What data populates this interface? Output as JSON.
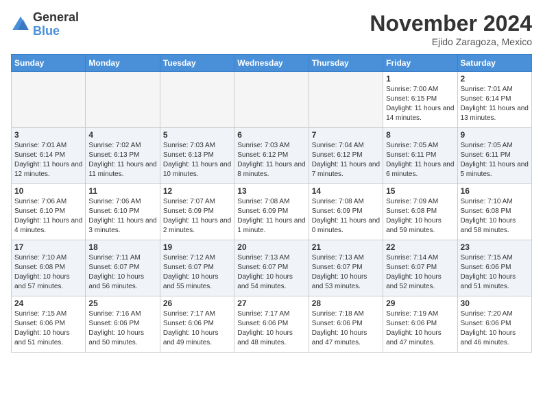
{
  "logo": {
    "general": "General",
    "blue": "Blue"
  },
  "title": "November 2024",
  "location": "Ejido Zaragoza, Mexico",
  "weekdays": [
    "Sunday",
    "Monday",
    "Tuesday",
    "Wednesday",
    "Thursday",
    "Friday",
    "Saturday"
  ],
  "weeks": [
    [
      {
        "day": "",
        "info": ""
      },
      {
        "day": "",
        "info": ""
      },
      {
        "day": "",
        "info": ""
      },
      {
        "day": "",
        "info": ""
      },
      {
        "day": "",
        "info": ""
      },
      {
        "day": "1",
        "info": "Sunrise: 7:00 AM\nSunset: 6:15 PM\nDaylight: 11 hours and 14 minutes."
      },
      {
        "day": "2",
        "info": "Sunrise: 7:01 AM\nSunset: 6:14 PM\nDaylight: 11 hours and 13 minutes."
      }
    ],
    [
      {
        "day": "3",
        "info": "Sunrise: 7:01 AM\nSunset: 6:14 PM\nDaylight: 11 hours and 12 minutes."
      },
      {
        "day": "4",
        "info": "Sunrise: 7:02 AM\nSunset: 6:13 PM\nDaylight: 11 hours and 11 minutes."
      },
      {
        "day": "5",
        "info": "Sunrise: 7:03 AM\nSunset: 6:13 PM\nDaylight: 11 hours and 10 minutes."
      },
      {
        "day": "6",
        "info": "Sunrise: 7:03 AM\nSunset: 6:12 PM\nDaylight: 11 hours and 8 minutes."
      },
      {
        "day": "7",
        "info": "Sunrise: 7:04 AM\nSunset: 6:12 PM\nDaylight: 11 hours and 7 minutes."
      },
      {
        "day": "8",
        "info": "Sunrise: 7:05 AM\nSunset: 6:11 PM\nDaylight: 11 hours and 6 minutes."
      },
      {
        "day": "9",
        "info": "Sunrise: 7:05 AM\nSunset: 6:11 PM\nDaylight: 11 hours and 5 minutes."
      }
    ],
    [
      {
        "day": "10",
        "info": "Sunrise: 7:06 AM\nSunset: 6:10 PM\nDaylight: 11 hours and 4 minutes."
      },
      {
        "day": "11",
        "info": "Sunrise: 7:06 AM\nSunset: 6:10 PM\nDaylight: 11 hours and 3 minutes."
      },
      {
        "day": "12",
        "info": "Sunrise: 7:07 AM\nSunset: 6:09 PM\nDaylight: 11 hours and 2 minutes."
      },
      {
        "day": "13",
        "info": "Sunrise: 7:08 AM\nSunset: 6:09 PM\nDaylight: 11 hours and 1 minute."
      },
      {
        "day": "14",
        "info": "Sunrise: 7:08 AM\nSunset: 6:09 PM\nDaylight: 11 hours and 0 minutes."
      },
      {
        "day": "15",
        "info": "Sunrise: 7:09 AM\nSunset: 6:08 PM\nDaylight: 10 hours and 59 minutes."
      },
      {
        "day": "16",
        "info": "Sunrise: 7:10 AM\nSunset: 6:08 PM\nDaylight: 10 hours and 58 minutes."
      }
    ],
    [
      {
        "day": "17",
        "info": "Sunrise: 7:10 AM\nSunset: 6:08 PM\nDaylight: 10 hours and 57 minutes."
      },
      {
        "day": "18",
        "info": "Sunrise: 7:11 AM\nSunset: 6:07 PM\nDaylight: 10 hours and 56 minutes."
      },
      {
        "day": "19",
        "info": "Sunrise: 7:12 AM\nSunset: 6:07 PM\nDaylight: 10 hours and 55 minutes."
      },
      {
        "day": "20",
        "info": "Sunrise: 7:13 AM\nSunset: 6:07 PM\nDaylight: 10 hours and 54 minutes."
      },
      {
        "day": "21",
        "info": "Sunrise: 7:13 AM\nSunset: 6:07 PM\nDaylight: 10 hours and 53 minutes."
      },
      {
        "day": "22",
        "info": "Sunrise: 7:14 AM\nSunset: 6:07 PM\nDaylight: 10 hours and 52 minutes."
      },
      {
        "day": "23",
        "info": "Sunrise: 7:15 AM\nSunset: 6:06 PM\nDaylight: 10 hours and 51 minutes."
      }
    ],
    [
      {
        "day": "24",
        "info": "Sunrise: 7:15 AM\nSunset: 6:06 PM\nDaylight: 10 hours and 51 minutes."
      },
      {
        "day": "25",
        "info": "Sunrise: 7:16 AM\nSunset: 6:06 PM\nDaylight: 10 hours and 50 minutes."
      },
      {
        "day": "26",
        "info": "Sunrise: 7:17 AM\nSunset: 6:06 PM\nDaylight: 10 hours and 49 minutes."
      },
      {
        "day": "27",
        "info": "Sunrise: 7:17 AM\nSunset: 6:06 PM\nDaylight: 10 hours and 48 minutes."
      },
      {
        "day": "28",
        "info": "Sunrise: 7:18 AM\nSunset: 6:06 PM\nDaylight: 10 hours and 47 minutes."
      },
      {
        "day": "29",
        "info": "Sunrise: 7:19 AM\nSunset: 6:06 PM\nDaylight: 10 hours and 47 minutes."
      },
      {
        "day": "30",
        "info": "Sunrise: 7:20 AM\nSunset: 6:06 PM\nDaylight: 10 hours and 46 minutes."
      }
    ]
  ]
}
